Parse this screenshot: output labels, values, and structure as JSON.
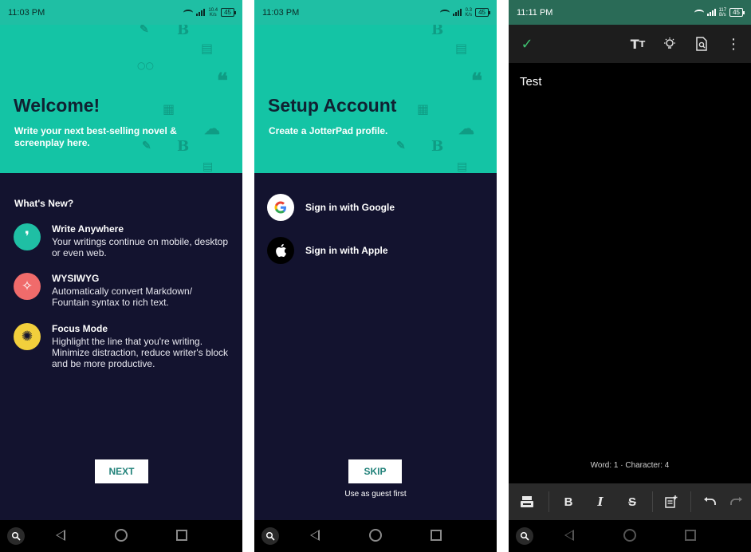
{
  "screens": [
    {
      "status_time": "11:03 PM",
      "status_speed": "10.4\nK/s",
      "battery": "45",
      "hero_title": "Welcome!",
      "hero_subtitle": "Write your next best-selling novel & screenplay here.",
      "section_heading": "What's New?",
      "features": [
        {
          "name": "Write Anywhere",
          "desc": "Your writings continue on mobile, desktop or even web.",
          "icon": "quote-icon",
          "color": "#1fbfa4"
        },
        {
          "name": "WYSIWYG",
          "desc": "Automatically convert Markdown/ Fountain syntax to rich text.",
          "icon": "magic-wand-icon",
          "color": "#f06b6b"
        },
        {
          "name": "Focus Mode",
          "desc": "Highlight the line that you're writing. Minimize distraction, reduce writer's block and be more productive.",
          "icon": "aperture-icon",
          "color": "#f2cf3c"
        }
      ],
      "primary_button": "NEXT"
    },
    {
      "status_time": "11:03 PM",
      "status_speed": "0.3\nK/s",
      "battery": "45",
      "hero_title": "Setup Account",
      "hero_subtitle": "Create a JotterPad profile.",
      "signin": [
        {
          "label": "Sign in with Google",
          "icon": "google-icon"
        },
        {
          "label": "Sign in with Apple",
          "icon": "apple-icon"
        }
      ],
      "primary_button": "SKIP",
      "secondary_text": "Use as guest first"
    },
    {
      "status_time": "11:11 PM",
      "status_speed": "117\nB/s",
      "battery": "45",
      "document_text": "Test",
      "word_count": "Word: 1 · Character: 4",
      "toolbar_icons": [
        "check-icon",
        "text-size-icon",
        "lightbulb-icon",
        "preview-icon",
        "more-vertical-icon"
      ],
      "format_icons": [
        "typewriter-icon",
        "bold-icon",
        "italic-icon",
        "strikethrough-icon",
        "add-note-icon",
        "undo-icon",
        "redo-icon"
      ]
    }
  ],
  "colors": {
    "teal": "#14c4a5",
    "navy": "#13132f",
    "accent_check": "#3fbf6f"
  }
}
